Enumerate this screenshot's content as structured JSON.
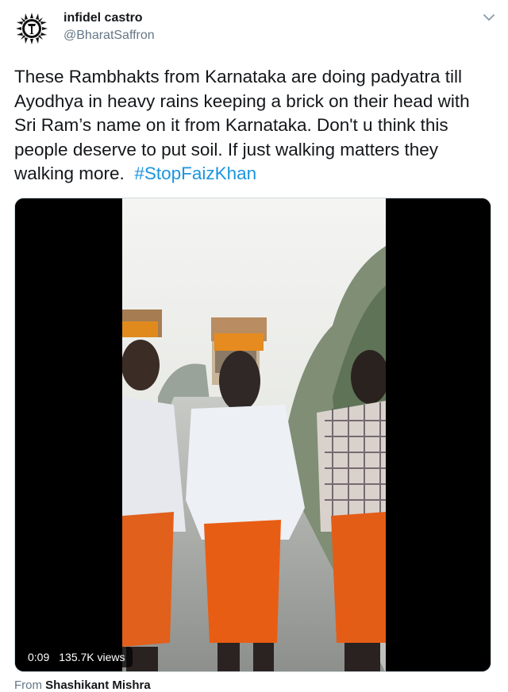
{
  "tweet": {
    "display_name": "infidel castro",
    "handle": "@BharatSaffron",
    "text_lines": [
      "These Rambhakts from Karnataka are doing padyatra till",
      "Ayodhya in heavy rains keeping a brick on their head with",
      "Sri Ram’s name on it from Karnataka. Don't u think this",
      "people deserve to put soil. If just walking matters they",
      "walking more."
    ],
    "hashtag": "#StopFaizKhan",
    "hashtag_color": "#1b95e0"
  },
  "video": {
    "time": "0:09",
    "views": "135.7K views"
  },
  "source": {
    "from_label": "From",
    "author": "Shashikant Mishra"
  },
  "icons": {
    "caret": "chevron-down-icon",
    "avatar": "avatar-emblem"
  }
}
